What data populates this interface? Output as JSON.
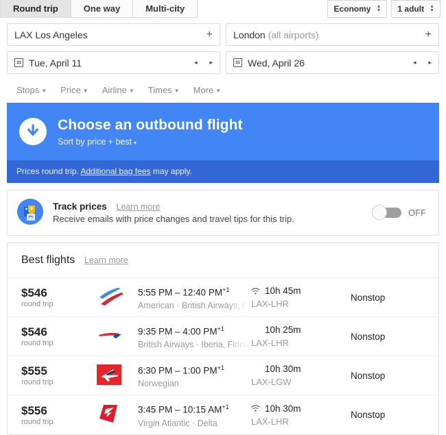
{
  "trip_tabs": [
    {
      "label": "Round trip",
      "active": true
    },
    {
      "label": "One way",
      "active": false
    },
    {
      "label": "Multi-city",
      "active": false
    }
  ],
  "selectors": {
    "cabin": "Economy",
    "passengers": "1 adult"
  },
  "search": {
    "origin_code": "LAX",
    "origin_city": "Los Angeles",
    "destination_city": "London",
    "destination_note": "(all airports)",
    "add_icon": "+",
    "depart_date": "Tue, April 11",
    "return_date": "Wed, April 26",
    "calendar_day": "31",
    "prev_arrow": "◂",
    "next_arrow": "▸"
  },
  "filters": [
    {
      "label": "Stops"
    },
    {
      "label": "Price"
    },
    {
      "label": "Airline"
    },
    {
      "label": "Times"
    },
    {
      "label": "More"
    }
  ],
  "banner": {
    "title": "Choose an outbound flight",
    "sort_label": "Sort by price + best",
    "caret": "▾",
    "footnote_prefix": "Prices round trip.",
    "footnote_link": "Additional bag fees",
    "footnote_suffix": "may apply.",
    "bg_color": "#4285F4",
    "foot_color": "#3367D6"
  },
  "track_prices": {
    "title": "Track prices",
    "learn_more": "Learn more",
    "description": "Receive emails with price changes and travel tips for this trip.",
    "toggle_state": "OFF"
  },
  "best_flights": {
    "heading": "Best flights",
    "learn_more": "Learn more",
    "rows": [
      {
        "price": "$546",
        "price_sub": "round trip",
        "logo": "american-airlines-logo",
        "times": "5:55 PM – 12:40 PM",
        "day_offset": "+1",
        "airlines": "American · British Airways, Finnair",
        "wifi": true,
        "duration": "10h 45m",
        "route": "LAX-LHR",
        "stops": "Nonstop"
      },
      {
        "price": "$546",
        "price_sub": "round trip",
        "logo": "british-airways-logo",
        "times": "9:35 PM – 4:00 PM",
        "day_offset": "+1",
        "airlines": "British Airways · Iberia, Finnair, American",
        "wifi": false,
        "duration": "10h 25m",
        "route": "LAX-LHR",
        "stops": "Nonstop"
      },
      {
        "price": "$555",
        "price_sub": "round trip",
        "logo": "norwegian-logo",
        "times": "6:30 PM – 1:00 PM",
        "day_offset": "+1",
        "airlines": "Norwegian",
        "wifi": false,
        "duration": "10h 30m",
        "route": "LAX-LGW",
        "stops": "Nonstop"
      },
      {
        "price": "$556",
        "price_sub": "round trip",
        "logo": "virgin-atlantic-logo",
        "times": "3:45 PM – 10:15 AM",
        "day_offset": "+1",
        "airlines": "Virgin Atlantic · Delta",
        "wifi": true,
        "duration": "10h 30m",
        "route": "LAX-LHR",
        "stops": "Nonstop"
      }
    ]
  }
}
